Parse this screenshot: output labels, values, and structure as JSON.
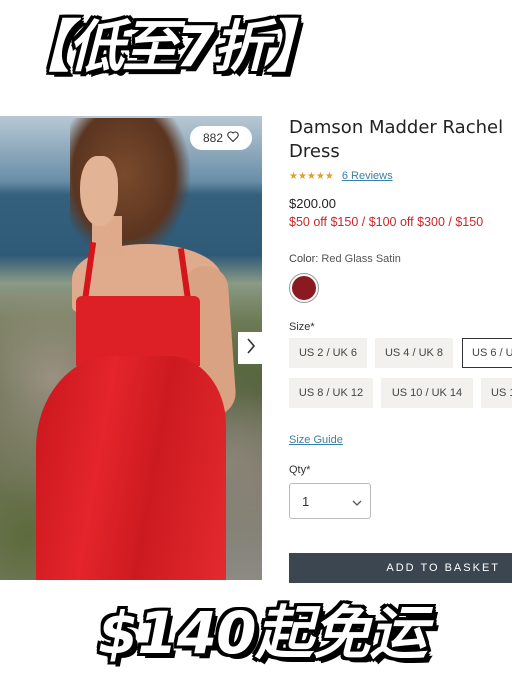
{
  "banner": {
    "top_text": "【低至7折】",
    "bottom_text": "$140起免运"
  },
  "photo": {
    "likes_count": "882"
  },
  "product": {
    "title": "Damson Madder Rachel Dress",
    "rating": {
      "stars": "★★★★★",
      "reviews_link": "6 Reviews"
    },
    "price": "$200.00",
    "promo": "$50 off $150 / $100 off $300 / $150",
    "color_label": "Color:",
    "color_value": "Red Glass Satin",
    "size_label": "Size*",
    "sizes": [
      "US 2 / UK 6",
      "US 4 / UK 8",
      "US 6 / U",
      "US 8 / UK 12",
      "US 10 / UK 14",
      "US 1"
    ],
    "selected_size": "US 6 / U",
    "size_guide": "Size Guide",
    "qty_label": "Qty*",
    "qty_value": "1",
    "add_to_basket": "ADD TO BASKET"
  },
  "colors": {
    "swatch": "#8a1a1f",
    "promo_red": "#c8282a",
    "link_blue": "#3a7fa5",
    "button_dark": "#3b4650"
  },
  "icons": {
    "heart": "heart-icon",
    "next": "chevron-right-icon",
    "dropdown": "chevron-down-icon"
  }
}
